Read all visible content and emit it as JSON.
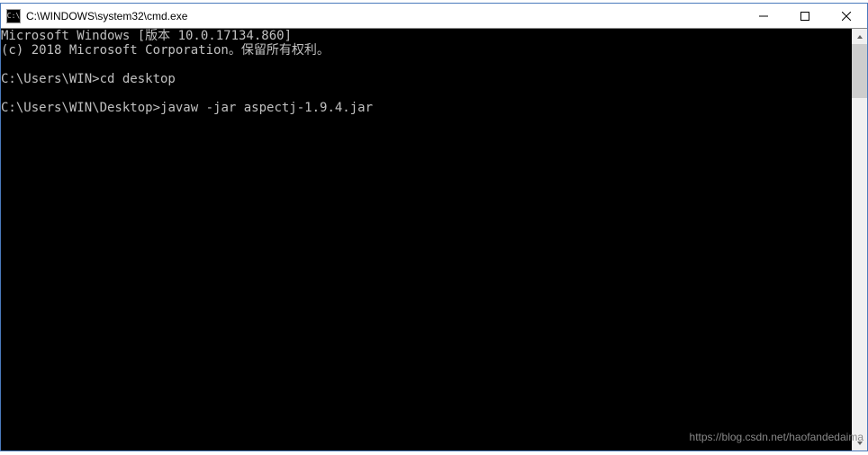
{
  "window": {
    "title": "C:\\WINDOWS\\system32\\cmd.exe",
    "icon_label": "C:\\"
  },
  "terminal": {
    "line1": "Microsoft Windows [版本 10.0.17134.860]",
    "line2": "(c) 2018 Microsoft Corporation。保留所有权利。",
    "prompt1": "C:\\Users\\WIN>",
    "cmd1": "cd desktop",
    "prompt2": "C:\\Users\\WIN\\Desktop>",
    "cmd2": "javaw -jar aspectj-1.9.4.jar"
  },
  "watermark": "https://blog.csdn.net/haofandedaima"
}
